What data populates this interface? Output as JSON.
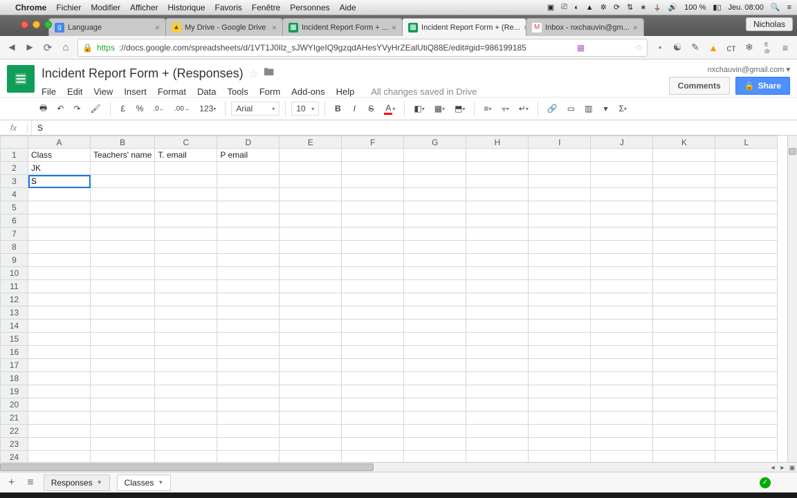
{
  "mac": {
    "app": "Chrome",
    "menus": [
      "Fichier",
      "Modifier",
      "Afficher",
      "Historique",
      "Favoris",
      "Fenêtre",
      "Personnes",
      "Aide"
    ],
    "battery": "100 %",
    "clock": "Jeu. 08:00"
  },
  "chrome": {
    "profile": "Nicholas",
    "tabs": [
      {
        "label": "Language",
        "fav": "g"
      },
      {
        "label": "My Drive - Google Drive",
        "fav": "d"
      },
      {
        "label": "Incident Report Form + ...",
        "fav": "s"
      },
      {
        "label": "Incident Report Form + (Re...",
        "fav": "s",
        "active": true
      },
      {
        "label": "Inbox - nxchauvin@gm...",
        "fav": "m"
      }
    ],
    "url_https": "https",
    "url_rest": "://docs.google.com/spreadsheets/d/1VT1J0Ilz_sJWYIgeIQ9gzqdAHesYVyHrZEalUtiQ88E/edit#gid=986199185"
  },
  "doc": {
    "title": "Incident Report Form + (Responses)",
    "account": "nxchauvin@gmail.com ▾",
    "menus": [
      "File",
      "Edit",
      "View",
      "Insert",
      "Format",
      "Data",
      "Tools",
      "Form",
      "Add-ons",
      "Help"
    ],
    "saved": "All changes saved in Drive",
    "comments": "Comments",
    "share": "Share"
  },
  "toolbar": {
    "font": "Arial",
    "size": "10",
    "currency": "£",
    "pct": "%",
    "dec0": ".0",
    "dec00": ".00",
    "num": "123"
  },
  "formula": {
    "fx": "fx",
    "value": "S"
  },
  "grid": {
    "cols": [
      "A",
      "B",
      "C",
      "D",
      "E",
      "F",
      "G",
      "H",
      "I",
      "J",
      "K",
      "L"
    ],
    "row_count": 24,
    "headers": {
      "A": "Class",
      "B": "Teachers' name",
      "C": "T. email",
      "D": "P email"
    },
    "cells": {
      "A2": "JK",
      "A3": "S"
    },
    "editing": "A3"
  },
  "tabs": {
    "add": "+",
    "list": "≡",
    "sheets": [
      {
        "name": "Responses"
      },
      {
        "name": "Classes",
        "active": true
      }
    ]
  }
}
